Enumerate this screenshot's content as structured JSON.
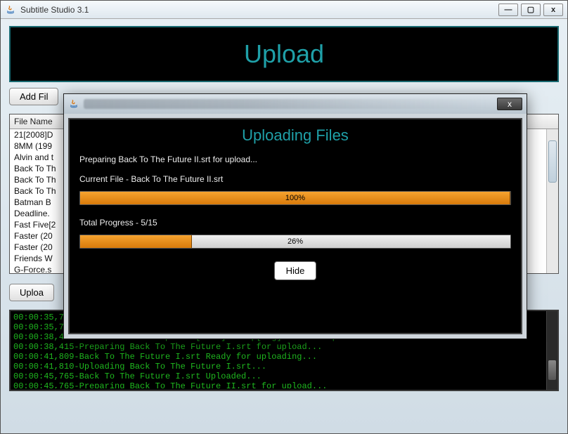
{
  "main": {
    "title": "Subtitle Studio 3.1",
    "header": "Upload",
    "add_files_label": "Add Fil",
    "upload_label": "Uploa",
    "table_header": "File Name",
    "files": [
      "21[2008]D",
      "8MM (199",
      "Alvin and t",
      "Back To Th",
      "Back To Th",
      "Back To Th",
      "Batman B",
      "Deadline.",
      "Fast Five[2",
      "Faster (20",
      "Faster (20",
      "Friends W",
      "G-Force.s"
    ]
  },
  "console": {
    "lines": [
      "00:00:35,700-Alvin and the Chipmunks[2007]DvDrip[Eng]-FXG.srt Ready for uploading...",
      "00:00:35,700-Uploading Alvin and the Chipmunks[2007]DvDrip[Eng]-FXG.srt...",
      "00:00:38,414-Alvin and the Chipmunks[2007]DvDrip[Eng]-FXG.srt Uploaded...",
      "00:00:38,415-Preparing Back To The Future I.srt for upload...",
      "00:00:41,809-Back To The Future I.srt Ready for uploading...",
      "00:00:41,810-Uploading Back To The Future I.srt...",
      "00:00:45,765-Back To The Future I.srt Uploaded...",
      "00:00:45,765-Preparing Back To The Future II.srt for upload..."
    ]
  },
  "dialog": {
    "heading": "Uploading Files",
    "status": "Preparing Back To The Future II.srt for upload...",
    "current_label": "Current File -  Back To The Future II.srt",
    "current_pct_text": "100%",
    "current_pct": 100,
    "total_label": "Total Progress -  5/15",
    "total_pct_text": "26%",
    "total_pct": 26,
    "hide_label": "Hide",
    "close_glyph": "x"
  },
  "win": {
    "min": "—",
    "max": "▢",
    "close": "x"
  }
}
